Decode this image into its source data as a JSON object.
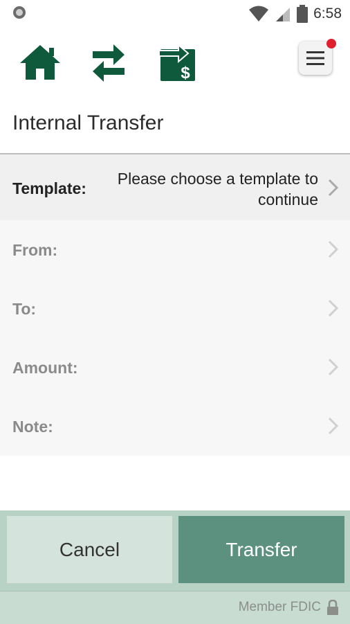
{
  "status_bar": {
    "time": "6:58"
  },
  "nav": {
    "home_icon": "home-icon",
    "transfer_icon": "transfer-arrows-icon",
    "bill_pay_icon": "bill-pay-icon",
    "menu_icon": "hamburger-menu-icon"
  },
  "page": {
    "title": "Internal Transfer"
  },
  "form": {
    "template": {
      "label": "Template:",
      "value": "Please choose a template to continue"
    },
    "from": {
      "label": "From:"
    },
    "to": {
      "label": "To:"
    },
    "amount": {
      "label": "Amount:"
    },
    "note": {
      "label": "Note:"
    }
  },
  "actions": {
    "cancel": "Cancel",
    "transfer": "Transfer"
  },
  "footer": {
    "fdic": "Member FDIC"
  },
  "colors": {
    "brand_green": "#0f5a3c",
    "transfer_button": "#5c9180",
    "cancel_button": "#d5e3dd",
    "notification": "#e0202e"
  }
}
